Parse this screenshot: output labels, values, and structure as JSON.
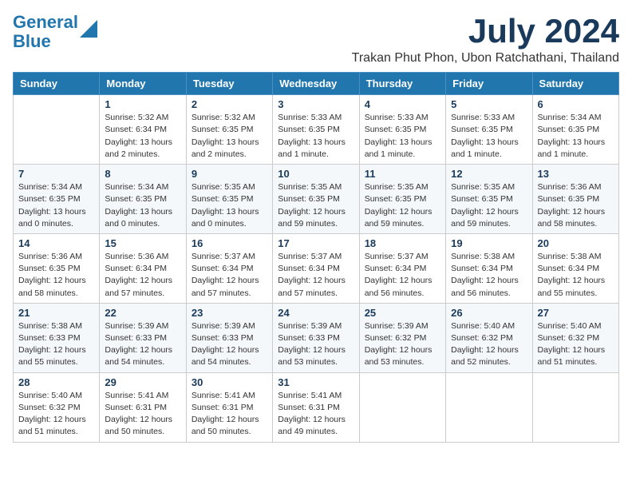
{
  "header": {
    "logo_line1": "General",
    "logo_line2": "Blue",
    "month_title": "July 2024",
    "location": "Trakan Phut Phon, Ubon Ratchathani, Thailand"
  },
  "weekdays": [
    "Sunday",
    "Monday",
    "Tuesday",
    "Wednesday",
    "Thursday",
    "Friday",
    "Saturday"
  ],
  "weeks": [
    [
      {
        "day": "",
        "info": ""
      },
      {
        "day": "1",
        "info": "Sunrise: 5:32 AM\nSunset: 6:34 PM\nDaylight: 13 hours\nand 2 minutes."
      },
      {
        "day": "2",
        "info": "Sunrise: 5:32 AM\nSunset: 6:35 PM\nDaylight: 13 hours\nand 2 minutes."
      },
      {
        "day": "3",
        "info": "Sunrise: 5:33 AM\nSunset: 6:35 PM\nDaylight: 13 hours\nand 1 minute."
      },
      {
        "day": "4",
        "info": "Sunrise: 5:33 AM\nSunset: 6:35 PM\nDaylight: 13 hours\nand 1 minute."
      },
      {
        "day": "5",
        "info": "Sunrise: 5:33 AM\nSunset: 6:35 PM\nDaylight: 13 hours\nand 1 minute."
      },
      {
        "day": "6",
        "info": "Sunrise: 5:34 AM\nSunset: 6:35 PM\nDaylight: 13 hours\nand 1 minute."
      }
    ],
    [
      {
        "day": "7",
        "info": "Sunrise: 5:34 AM\nSunset: 6:35 PM\nDaylight: 13 hours\nand 0 minutes."
      },
      {
        "day": "8",
        "info": "Sunrise: 5:34 AM\nSunset: 6:35 PM\nDaylight: 13 hours\nand 0 minutes."
      },
      {
        "day": "9",
        "info": "Sunrise: 5:35 AM\nSunset: 6:35 PM\nDaylight: 13 hours\nand 0 minutes."
      },
      {
        "day": "10",
        "info": "Sunrise: 5:35 AM\nSunset: 6:35 PM\nDaylight: 12 hours\nand 59 minutes."
      },
      {
        "day": "11",
        "info": "Sunrise: 5:35 AM\nSunset: 6:35 PM\nDaylight: 12 hours\nand 59 minutes."
      },
      {
        "day": "12",
        "info": "Sunrise: 5:35 AM\nSunset: 6:35 PM\nDaylight: 12 hours\nand 59 minutes."
      },
      {
        "day": "13",
        "info": "Sunrise: 5:36 AM\nSunset: 6:35 PM\nDaylight: 12 hours\nand 58 minutes."
      }
    ],
    [
      {
        "day": "14",
        "info": "Sunrise: 5:36 AM\nSunset: 6:35 PM\nDaylight: 12 hours\nand 58 minutes."
      },
      {
        "day": "15",
        "info": "Sunrise: 5:36 AM\nSunset: 6:34 PM\nDaylight: 12 hours\nand 57 minutes."
      },
      {
        "day": "16",
        "info": "Sunrise: 5:37 AM\nSunset: 6:34 PM\nDaylight: 12 hours\nand 57 minutes."
      },
      {
        "day": "17",
        "info": "Sunrise: 5:37 AM\nSunset: 6:34 PM\nDaylight: 12 hours\nand 57 minutes."
      },
      {
        "day": "18",
        "info": "Sunrise: 5:37 AM\nSunset: 6:34 PM\nDaylight: 12 hours\nand 56 minutes."
      },
      {
        "day": "19",
        "info": "Sunrise: 5:38 AM\nSunset: 6:34 PM\nDaylight: 12 hours\nand 56 minutes."
      },
      {
        "day": "20",
        "info": "Sunrise: 5:38 AM\nSunset: 6:34 PM\nDaylight: 12 hours\nand 55 minutes."
      }
    ],
    [
      {
        "day": "21",
        "info": "Sunrise: 5:38 AM\nSunset: 6:33 PM\nDaylight: 12 hours\nand 55 minutes."
      },
      {
        "day": "22",
        "info": "Sunrise: 5:39 AM\nSunset: 6:33 PM\nDaylight: 12 hours\nand 54 minutes."
      },
      {
        "day": "23",
        "info": "Sunrise: 5:39 AM\nSunset: 6:33 PM\nDaylight: 12 hours\nand 54 minutes."
      },
      {
        "day": "24",
        "info": "Sunrise: 5:39 AM\nSunset: 6:33 PM\nDaylight: 12 hours\nand 53 minutes."
      },
      {
        "day": "25",
        "info": "Sunrise: 5:39 AM\nSunset: 6:32 PM\nDaylight: 12 hours\nand 53 minutes."
      },
      {
        "day": "26",
        "info": "Sunrise: 5:40 AM\nSunset: 6:32 PM\nDaylight: 12 hours\nand 52 minutes."
      },
      {
        "day": "27",
        "info": "Sunrise: 5:40 AM\nSunset: 6:32 PM\nDaylight: 12 hours\nand 51 minutes."
      }
    ],
    [
      {
        "day": "28",
        "info": "Sunrise: 5:40 AM\nSunset: 6:32 PM\nDaylight: 12 hours\nand 51 minutes."
      },
      {
        "day": "29",
        "info": "Sunrise: 5:41 AM\nSunset: 6:31 PM\nDaylight: 12 hours\nand 50 minutes."
      },
      {
        "day": "30",
        "info": "Sunrise: 5:41 AM\nSunset: 6:31 PM\nDaylight: 12 hours\nand 50 minutes."
      },
      {
        "day": "31",
        "info": "Sunrise: 5:41 AM\nSunset: 6:31 PM\nDaylight: 12 hours\nand 49 minutes."
      },
      {
        "day": "",
        "info": ""
      },
      {
        "day": "",
        "info": ""
      },
      {
        "day": "",
        "info": ""
      }
    ]
  ]
}
